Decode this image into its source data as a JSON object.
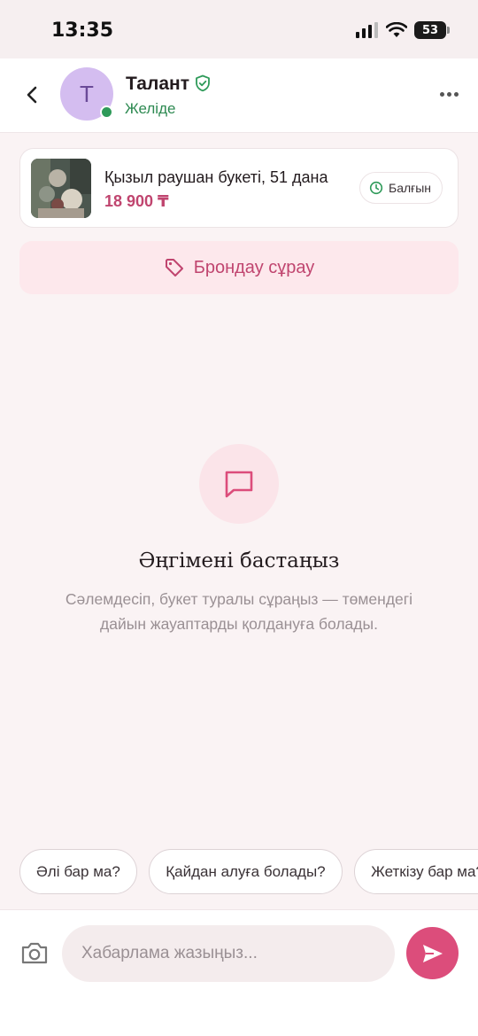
{
  "status_bar": {
    "time": "13:35",
    "battery": "53"
  },
  "header": {
    "avatar_letter": "Т",
    "name": "Талант",
    "status": "Желіде"
  },
  "product": {
    "title": "Қызыл раушан букеті, 51 дана",
    "price": "18 900 ₸",
    "status_pill": "Балғын"
  },
  "booking": {
    "label": "Брондау сұрау"
  },
  "empty_state": {
    "title": "Әңгімені бастаңыз",
    "description": "Сәлемдесіп, букет туралы сұраңыз — төмендегі дайын жауаптарды қолдануға болады."
  },
  "quick_replies": [
    "Әлі бар ма?",
    "Қайдан алуға болады?",
    "Жеткізу бар ма?"
  ],
  "composer": {
    "placeholder": "Хабарлама жазыңыз..."
  },
  "colors": {
    "accent": "#dc4d7b",
    "price": "#c0456f",
    "online": "#2e9a59"
  }
}
